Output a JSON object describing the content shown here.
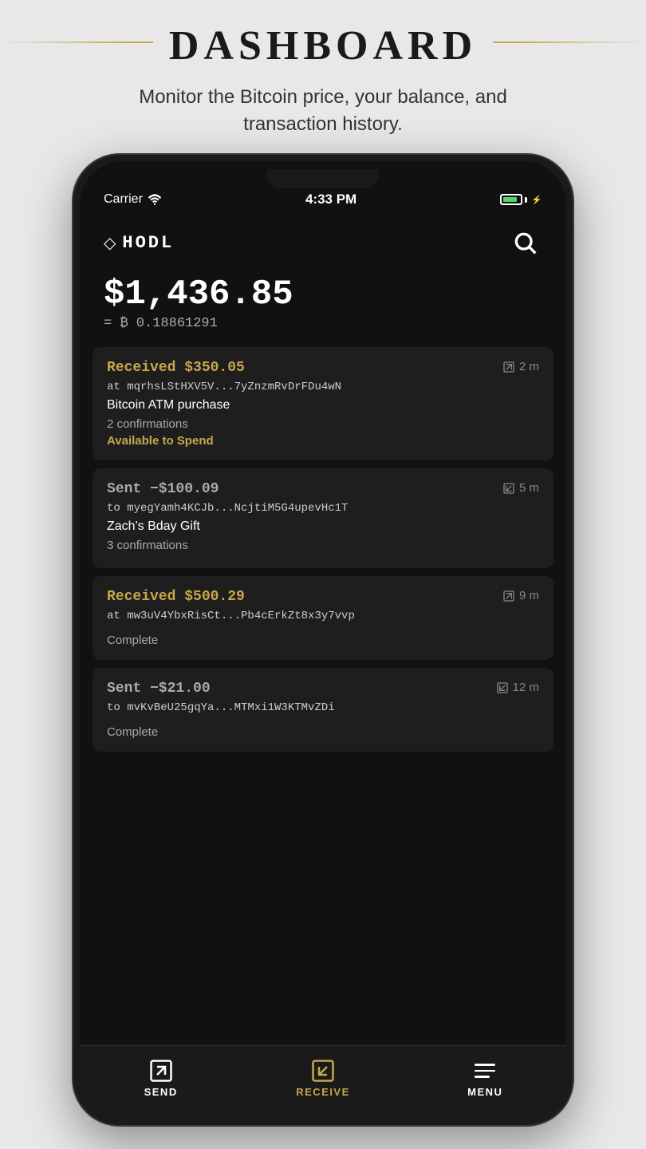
{
  "page": {
    "title": "DASHBOARD",
    "subtitle": "Monitor the Bitcoin price, your balance, and transaction history."
  },
  "status_bar": {
    "carrier": "Carrier",
    "time": "4:33 PM"
  },
  "app": {
    "logo": "◇HODL",
    "balance_usd": "$1,436.85",
    "balance_eq": "= ₿ 0.18861291"
  },
  "transactions": [
    {
      "type": "received",
      "amount": "Received $350.05",
      "address": "at mqrhsLStHXV5V...7yZnzmRvDrFDu4wN",
      "time": "2 m",
      "label": "Bitcoin ATM purchase",
      "confirmations": "2 confirmations",
      "status": "Available to Spend",
      "status_type": "available"
    },
    {
      "type": "sent",
      "amount": "Sent −$100.09",
      "address": "to myegYamh4KCJb...NcjtiM5G4upevHc1T",
      "time": "5 m",
      "label": "Zach's Bday Gift",
      "confirmations": "3 confirmations",
      "status": "",
      "status_type": "none"
    },
    {
      "type": "received",
      "amount": "Received $500.29",
      "address": "at mw3uV4YbxRisCt...Pb4cErkZt8x3y7vvp",
      "time": "9 m",
      "label": "",
      "confirmations": "",
      "status": "Complete",
      "status_type": "complete"
    },
    {
      "type": "sent",
      "amount": "Sent −$21.00",
      "address": "to mvKvBeU25gqYa...MTMxi1W3KTMvZDi",
      "time": "12 m",
      "label": "",
      "confirmations": "",
      "status": "Complete",
      "status_type": "complete"
    }
  ],
  "nav": {
    "send": "SEND",
    "receive": "RECEIVE",
    "menu": "MENU"
  }
}
